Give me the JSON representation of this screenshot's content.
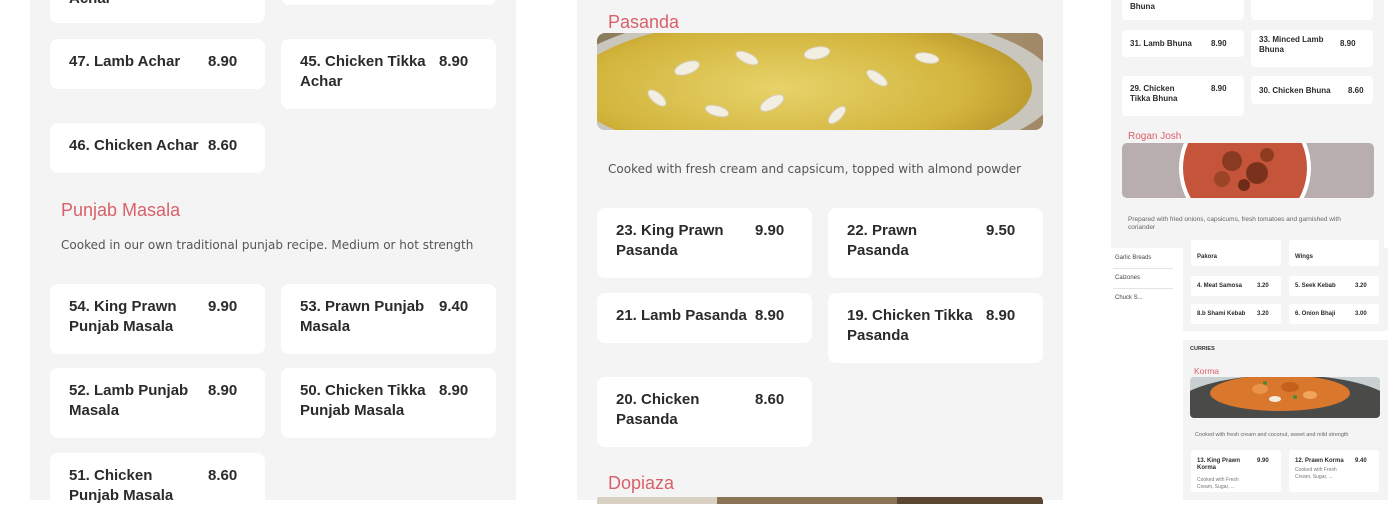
{
  "left": {
    "top_partial": {
      "name": "Achar"
    },
    "cards": [
      {
        "name": "47. Lamb Achar",
        "price": "8.90"
      },
      {
        "name": "45. Chicken Tikka Achar",
        "price": "8.90"
      },
      {
        "name": "46. Chicken Achar",
        "price": "8.60"
      }
    ],
    "punjab": {
      "title": "Punjab Masala",
      "desc": "Cooked in our own traditional punjab recipe. Medium or hot strength",
      "cards": [
        {
          "name": "54. King Prawn Punjab Masala",
          "price": "9.90"
        },
        {
          "name": "53. Prawn Punjab Masala",
          "price": "9.40"
        },
        {
          "name": "52. Lamb Punjab Masala",
          "price": "8.90"
        },
        {
          "name": "50. Chicken Tikka Punjab Masala",
          "price": "8.90"
        },
        {
          "name": "51. Chicken Punjab Masala",
          "price": "8.60"
        }
      ]
    }
  },
  "middle": {
    "pasanda": {
      "title": "Pasanda",
      "desc": "Cooked with fresh cream and capsicum, topped with almond powder",
      "cards": [
        {
          "name": "23. King Prawn Pasanda",
          "price": "9.90"
        },
        {
          "name": "22. Prawn Pasanda",
          "price": "9.50"
        },
        {
          "name": "21. Lamb Pasanda",
          "price": "8.90"
        },
        {
          "name": "19. Chicken Tikka Pasanda",
          "price": "8.90"
        },
        {
          "name": "20. Chicken Pasanda",
          "price": "8.60"
        }
      ]
    },
    "dopiaza": {
      "title": "Dopiaza"
    }
  },
  "right_top": {
    "partial": "Bhuna",
    "cards": [
      {
        "name": "31. Lamb Bhuna",
        "price": "8.90"
      },
      {
        "name": "33. Minced Lamb Bhuna",
        "price": "8.90"
      },
      {
        "name": "29. Chicken Tikka Bhuna",
        "price": "8.90"
      },
      {
        "name": "30. Chicken Bhuna",
        "price": "8.60"
      }
    ],
    "rogan": {
      "title": "Rogan Josh",
      "desc": "Prepared with fried onions, capsicums, fresh tomatoes and garnished with coriander"
    }
  },
  "right_bottom": {
    "sidebar": [
      "Garlic Breads",
      "Calzones",
      "Chuck S..."
    ],
    "starters": [
      {
        "name": "Pakora",
        "price": "3.20"
      },
      {
        "name": "Wings",
        "price": "3.20"
      },
      {
        "name": "4. Meat Samosa",
        "price": "3.20"
      },
      {
        "name": "5. Seek Kebab",
        "price": "3.20"
      },
      {
        "name": "8.b Shami Kebab",
        "price": "3.20"
      },
      {
        "name": "6. Onion Bhaji",
        "price": "3.00"
      }
    ],
    "curries_label": "CURRIES",
    "korma": {
      "title": "Korma",
      "desc": "Cooked with fresh cream and coconut, sweet and mild strength",
      "cards": [
        {
          "name": "13. King Prawn Korma",
          "price": "9.90",
          "sub": "Cooked with Fresh Cream, Sugar, ..."
        },
        {
          "name": "12. Prawn Korma",
          "price": "9.40",
          "sub": "Cooked with Fresh Cream, Sugar, ..."
        }
      ]
    }
  }
}
